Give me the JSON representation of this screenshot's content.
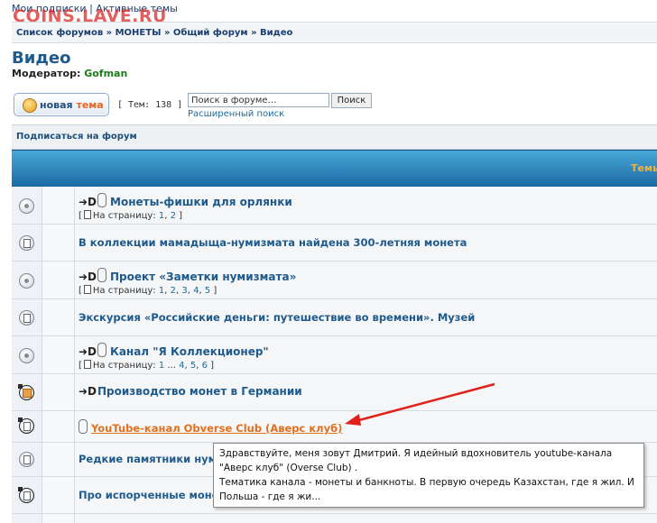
{
  "top_links": {
    "subscriptions": "Мои подписки",
    "separator": "|",
    "active_topics": "Активные темы"
  },
  "watermark": "COINS.LAVE.RU",
  "breadcrumb": {
    "items": [
      "Список форумов",
      "МОНЕТЫ",
      "Общий форум",
      "Видео"
    ],
    "separator": "»"
  },
  "forum": {
    "title": "Видео",
    "moderator_label": "Модератор:",
    "moderator_name": "Gofman"
  },
  "new_topic_button": {
    "word1": "новая",
    "word2": "тема"
  },
  "topic_count": "[ Тем: 138 ]",
  "search": {
    "placeholder": "Поиск в форуме…",
    "button": "Поиск",
    "advanced": "Расширенный поиск"
  },
  "subscribe_link": "Подписаться на форум",
  "table_header": {
    "topics": "Темы"
  },
  "topics": [
    {
      "title": "Монеты-фишки для орлянки",
      "markers": "➜D",
      "attachment": true,
      "pages_label": "На страницу:",
      "pages": [
        "1",
        "2"
      ]
    },
    {
      "title": "В коллекции мамадыща-нумизмата найдена 300-летняя монета",
      "attachment": false
    },
    {
      "title": "Проект «Заметки нумизмата»",
      "markers": "➜D",
      "attachment": true,
      "pages_label": "На страницу:",
      "pages": [
        "1",
        "2",
        "3",
        "4",
        "5"
      ]
    },
    {
      "title": "Экскурсия «Российские деньги: путешествие во времени». Музей",
      "attachment": false
    },
    {
      "title": "Канал \"Я Коллекционер\"",
      "markers": "➜D",
      "attachment": true,
      "pages_label": "На страницу:",
      "pages": [
        "1",
        "...",
        "4",
        "5",
        "6"
      ]
    },
    {
      "title": "Производство монет в Германии",
      "markers": "➜D",
      "attachment": false
    },
    {
      "title": "YouTube-канал Obverse Club (Аверс клуб)",
      "attachment": true,
      "highlighted": true
    },
    {
      "title": "Редкие памятники нумизм",
      "attachment": false
    },
    {
      "title": "Про испорченные монеты",
      "attachment": false
    }
  ],
  "tooltip": {
    "line1": "Здравствуйте, меня зовут Дмитрий. Я идейный вдохновитель  youtube-канала",
    "line2": "\"Аверс клуб\" (Overse Club) .",
    "line3": "Тематика канала - монеты и банкноты. В первую очередь Казахстан, где я жил. И",
    "line4": "Польша - где я жи..."
  },
  "colors": {
    "link": "#1f5a8c",
    "header_bar": "#2b86c0",
    "accent_orange": "#e2701f",
    "arrow_red": "#e0201a"
  }
}
